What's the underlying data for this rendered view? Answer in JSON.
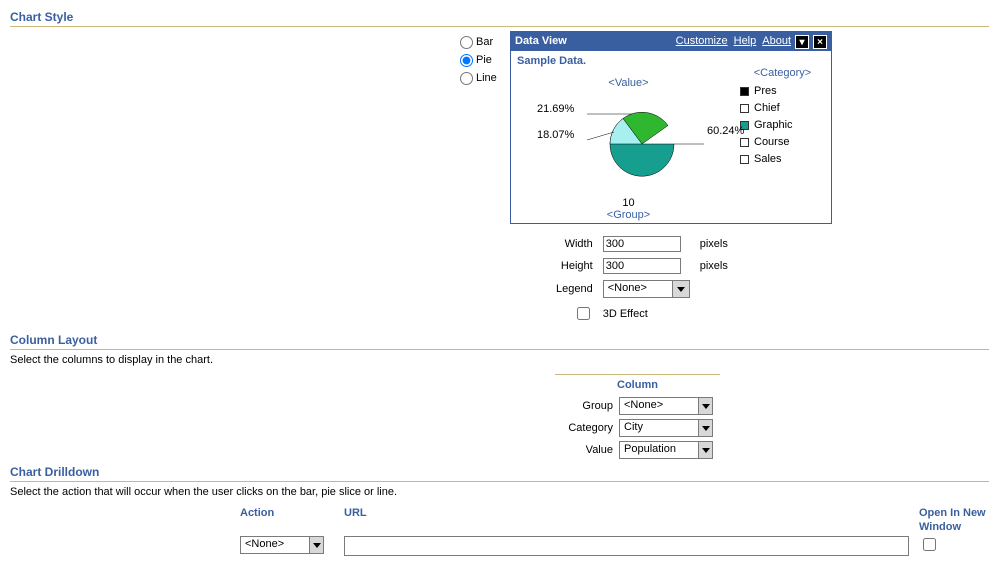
{
  "sections": {
    "chart_style": {
      "title": "Chart Style"
    },
    "column_layout": {
      "title": "Column Layout",
      "desc": "Select the columns to display in the chart."
    },
    "chart_drilldown": {
      "title": "Chart Drilldown",
      "desc": "Select the action that will occur when the user clicks on the bar, pie slice or line."
    }
  },
  "radios": {
    "bar": "Bar",
    "pie": "Pie",
    "line": "Line",
    "selected": "Pie"
  },
  "preview": {
    "title": "Data View",
    "links": {
      "customize": "Customize",
      "help": "Help",
      "about": "About"
    },
    "sample": "Sample Data.",
    "value_label": "<Value>",
    "category_label": "<Category>",
    "group_label": "<Group>",
    "group_value": "10",
    "legend": [
      "Pres",
      "Chief",
      "Graphic",
      "Course",
      "Sales"
    ]
  },
  "chart_data": {
    "type": "pie",
    "title": "Sample Data.",
    "categories": [
      "Pres",
      "Chief",
      "Graphic",
      "Course",
      "Sales"
    ],
    "values": [
      60.24,
      21.69,
      18.07
    ],
    "labels": [
      "60.24%",
      "21.69%",
      "18.07%"
    ],
    "group": "10"
  },
  "size_form": {
    "width_label": "Width",
    "width_value": "300",
    "width_unit": "pixels",
    "height_label": "Height",
    "height_value": "300",
    "height_unit": "pixels",
    "legend_label": "Legend",
    "legend_value": "<None>",
    "effect_label": "3D Effect"
  },
  "column_layout": {
    "header": "Column",
    "group_label": "Group",
    "group_value": "<None>",
    "category_label": "Category",
    "category_value": "City",
    "value_label": "Value",
    "value_value": "Population"
  },
  "drilldown": {
    "action_header": "Action",
    "url_header": "URL",
    "open_header": "Open In New Window",
    "action_value": "<None>",
    "url_value": ""
  }
}
